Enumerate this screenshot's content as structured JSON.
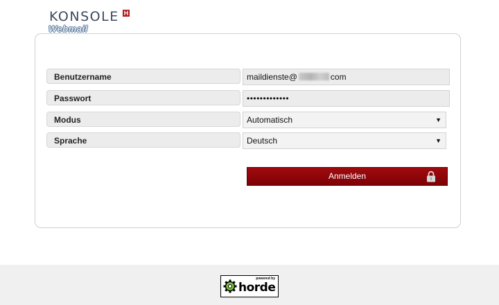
{
  "brand": {
    "name": "KONSOLE",
    "mark": "H",
    "subtitle": "Webmail"
  },
  "form": {
    "username": {
      "label": "Benutzername",
      "value_prefix": "maildienste@",
      "value_suffix": "com"
    },
    "password": {
      "label": "Passwort",
      "value": "•••••••••••••"
    },
    "mode": {
      "label": "Modus",
      "selected": "Automatisch"
    },
    "language": {
      "label": "Sprache",
      "selected": "Deutsch"
    },
    "submit_label": "Anmelden"
  },
  "footer": {
    "badge_small": "powered by",
    "badge_word": "horde"
  },
  "colors": {
    "accent": "#8f0609",
    "brand_text": "#3b4a5c"
  },
  "icons": {
    "submit": "lock-icon",
    "badge": "horde-gear-icon",
    "select": "chevron-down-icon"
  }
}
